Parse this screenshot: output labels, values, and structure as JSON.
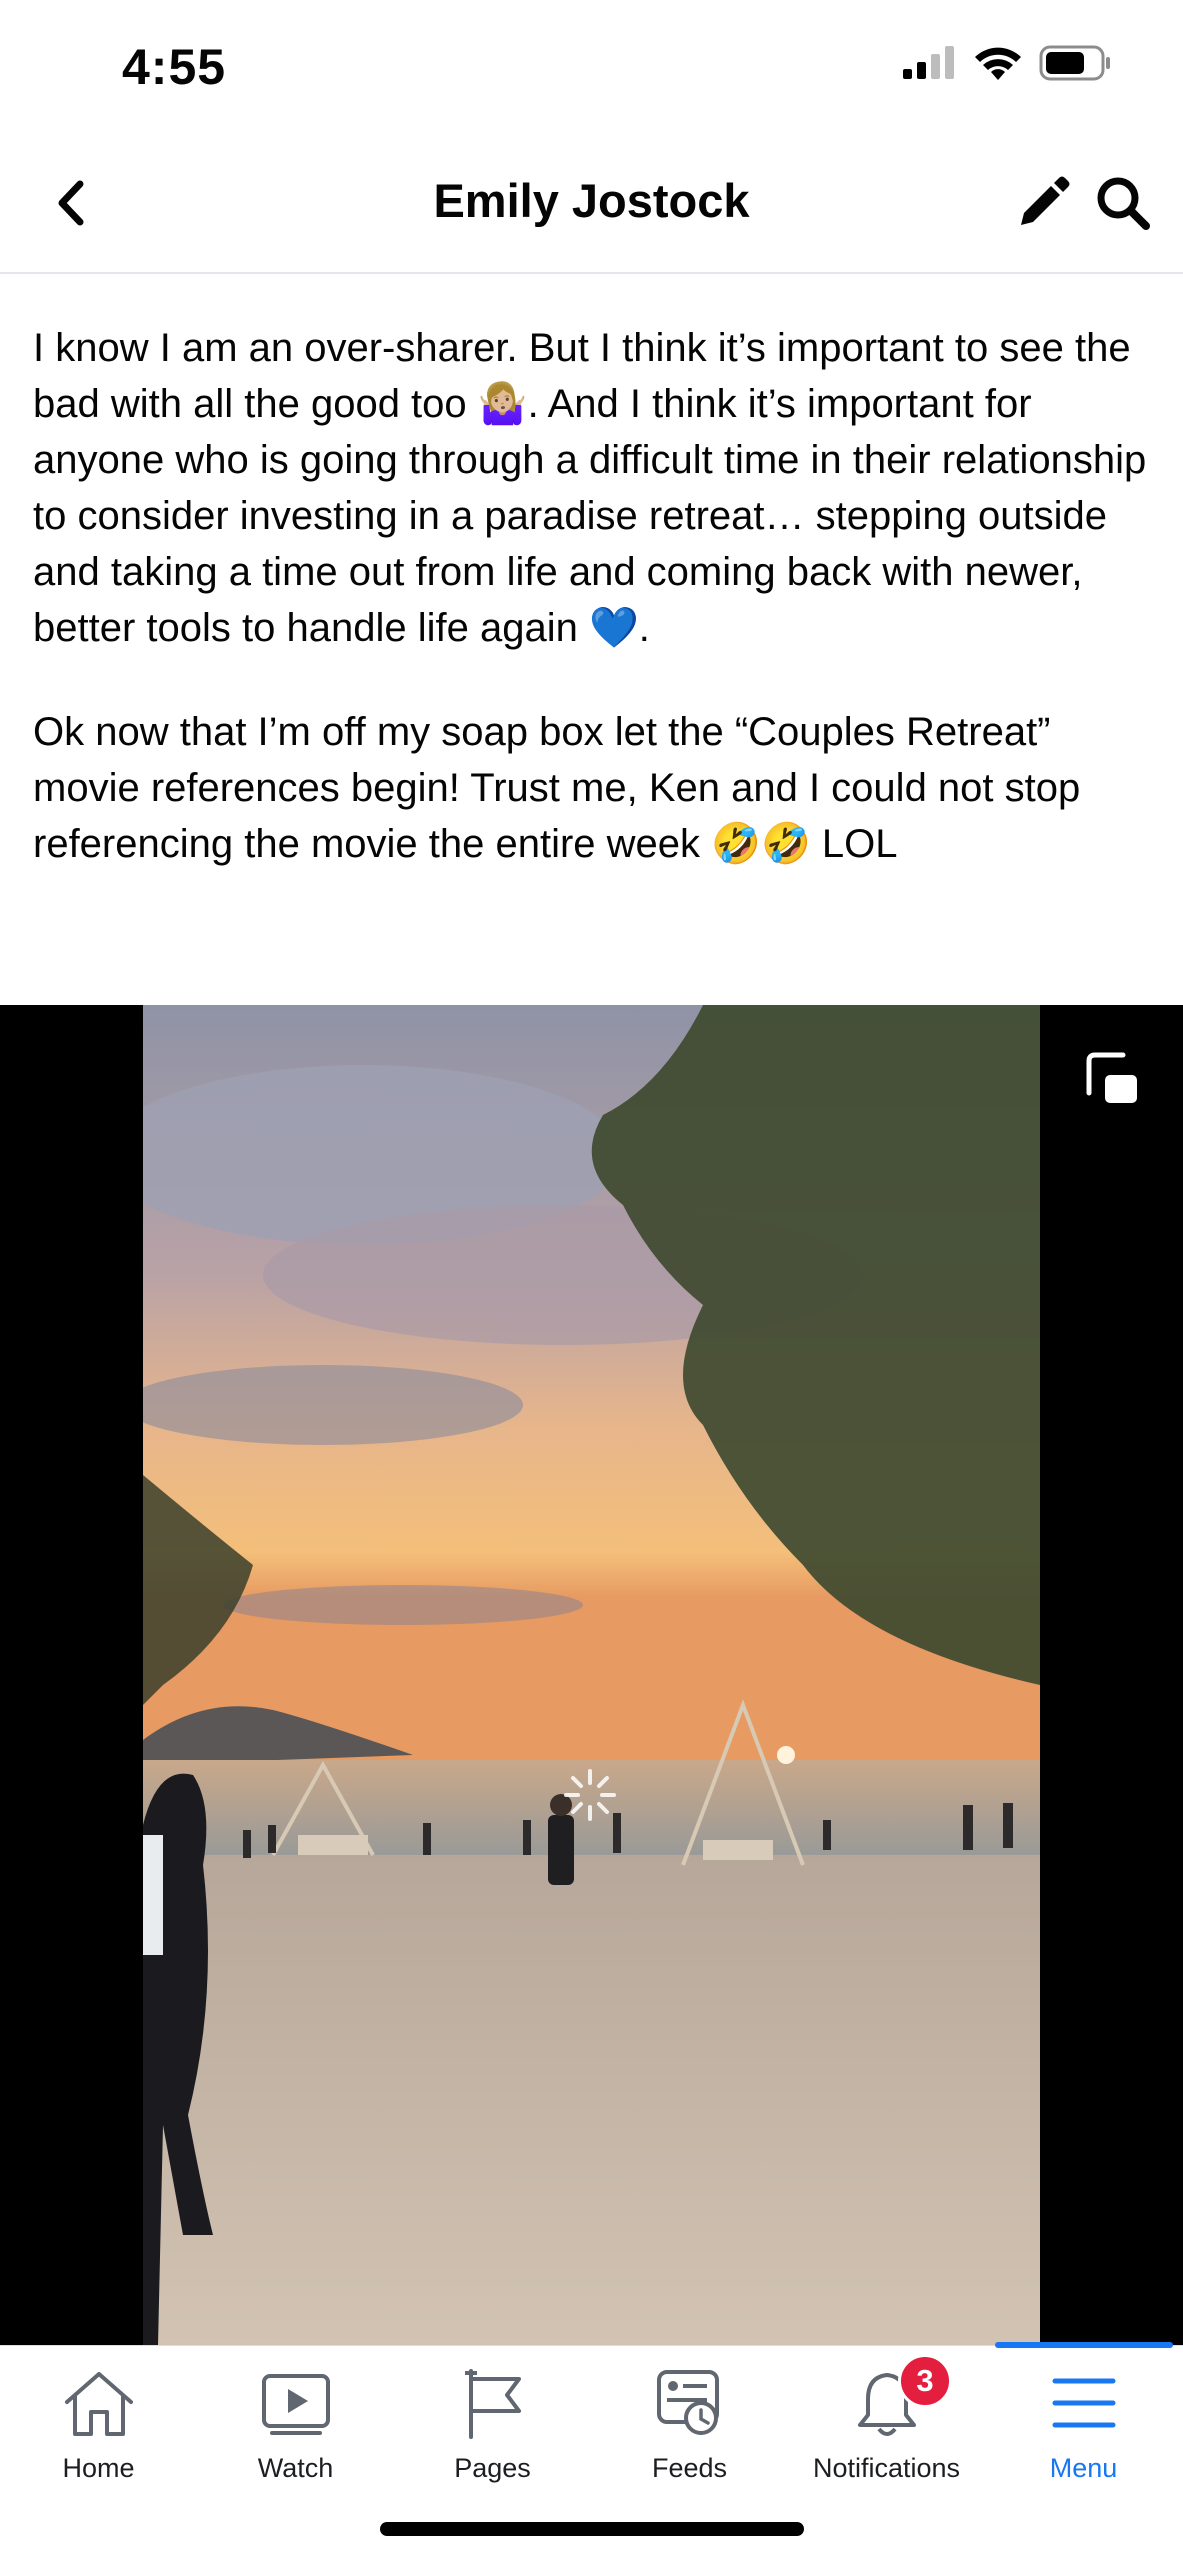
{
  "status_bar": {
    "time": "4:55",
    "icons": [
      "signal-icon",
      "wifi-icon",
      "battery-icon"
    ]
  },
  "header": {
    "title": "Emily Jostock",
    "icons": [
      "chevron-left-icon",
      "pencil-icon",
      "search-icon"
    ]
  },
  "post": {
    "paragraph_1": "I know I am an over-sharer. But I think it’s important to see the bad with all the good too 🤷🏼‍♀️. And I think it’s important for anyone who is going through a difficult time in their relationship to consider investing in a paradise retreat… stepping outside and taking a time out from life and coming back with newer, better tools to handle life again 💙.",
    "paragraph_2": "Ok now that I’m off my soap box let the “Couples Retreat” movie references begin! Trust me, Ken and I could not stop referencing the movie the entire week 🤣🤣 LOL"
  },
  "video": {
    "icon": "picture-in-picture-icon",
    "state_icon": "loading-spinner-icon"
  },
  "tabbar": {
    "active": "Menu",
    "accent_color": "#1877f2",
    "tabs": [
      {
        "label": "Home",
        "icon": "home-icon"
      },
      {
        "label": "Watch",
        "icon": "watch-play-icon"
      },
      {
        "label": "Pages",
        "icon": "flag-icon"
      },
      {
        "label": "Feeds",
        "icon": "feeds-clock-icon"
      },
      {
        "label": "Notifications",
        "icon": "bell-icon",
        "badge": "3"
      },
      {
        "label": "Menu",
        "icon": "hamburger-menu-icon"
      }
    ]
  }
}
